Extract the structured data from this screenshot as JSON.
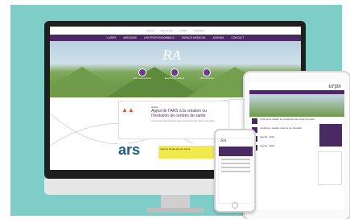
{
  "desktop": {
    "topbar": [
      "accueil",
      "plan du site",
      "contact",
      "recherche"
    ],
    "nav": [
      "L'URPS",
      "MISSIONS",
      "LES PROFESSIONNELS",
      "ESPACE MEDECIN",
      "AGENDA",
      "CONTACT"
    ],
    "logo": "RA",
    "quicklinks": [
      "Nos interventions",
      "Exercice en cabinet",
      "Offre de soins"
    ],
    "card": {
      "badge": "MAISONS DE SANTÉ PLURIPROFESSIONNELLES",
      "tag": "Article",
      "title": "Appui de l'ARS à la création ou l'évolution de centres de santé",
      "desc": "Un nouveau dispositif de soutien a la creation des maisons de sante..."
    },
    "ars": {
      "logo": "ars",
      "banner": "Agence Régionale de Santé"
    }
  },
  "tablet": {
    "logo": "urps",
    "items": [
      "L'Assurance maladie et la Fédération des centres de santé...",
      "Conférence: maladie, santé de vie, Actualités",
      "Agenda - 12/04",
      "Agenda - 18/04"
    ]
  },
  "phone": {
    "logo": "RA"
  },
  "colors": {
    "brand": "#4b2a63",
    "accent": "#e0502e",
    "teal": "#7fcdc7"
  }
}
